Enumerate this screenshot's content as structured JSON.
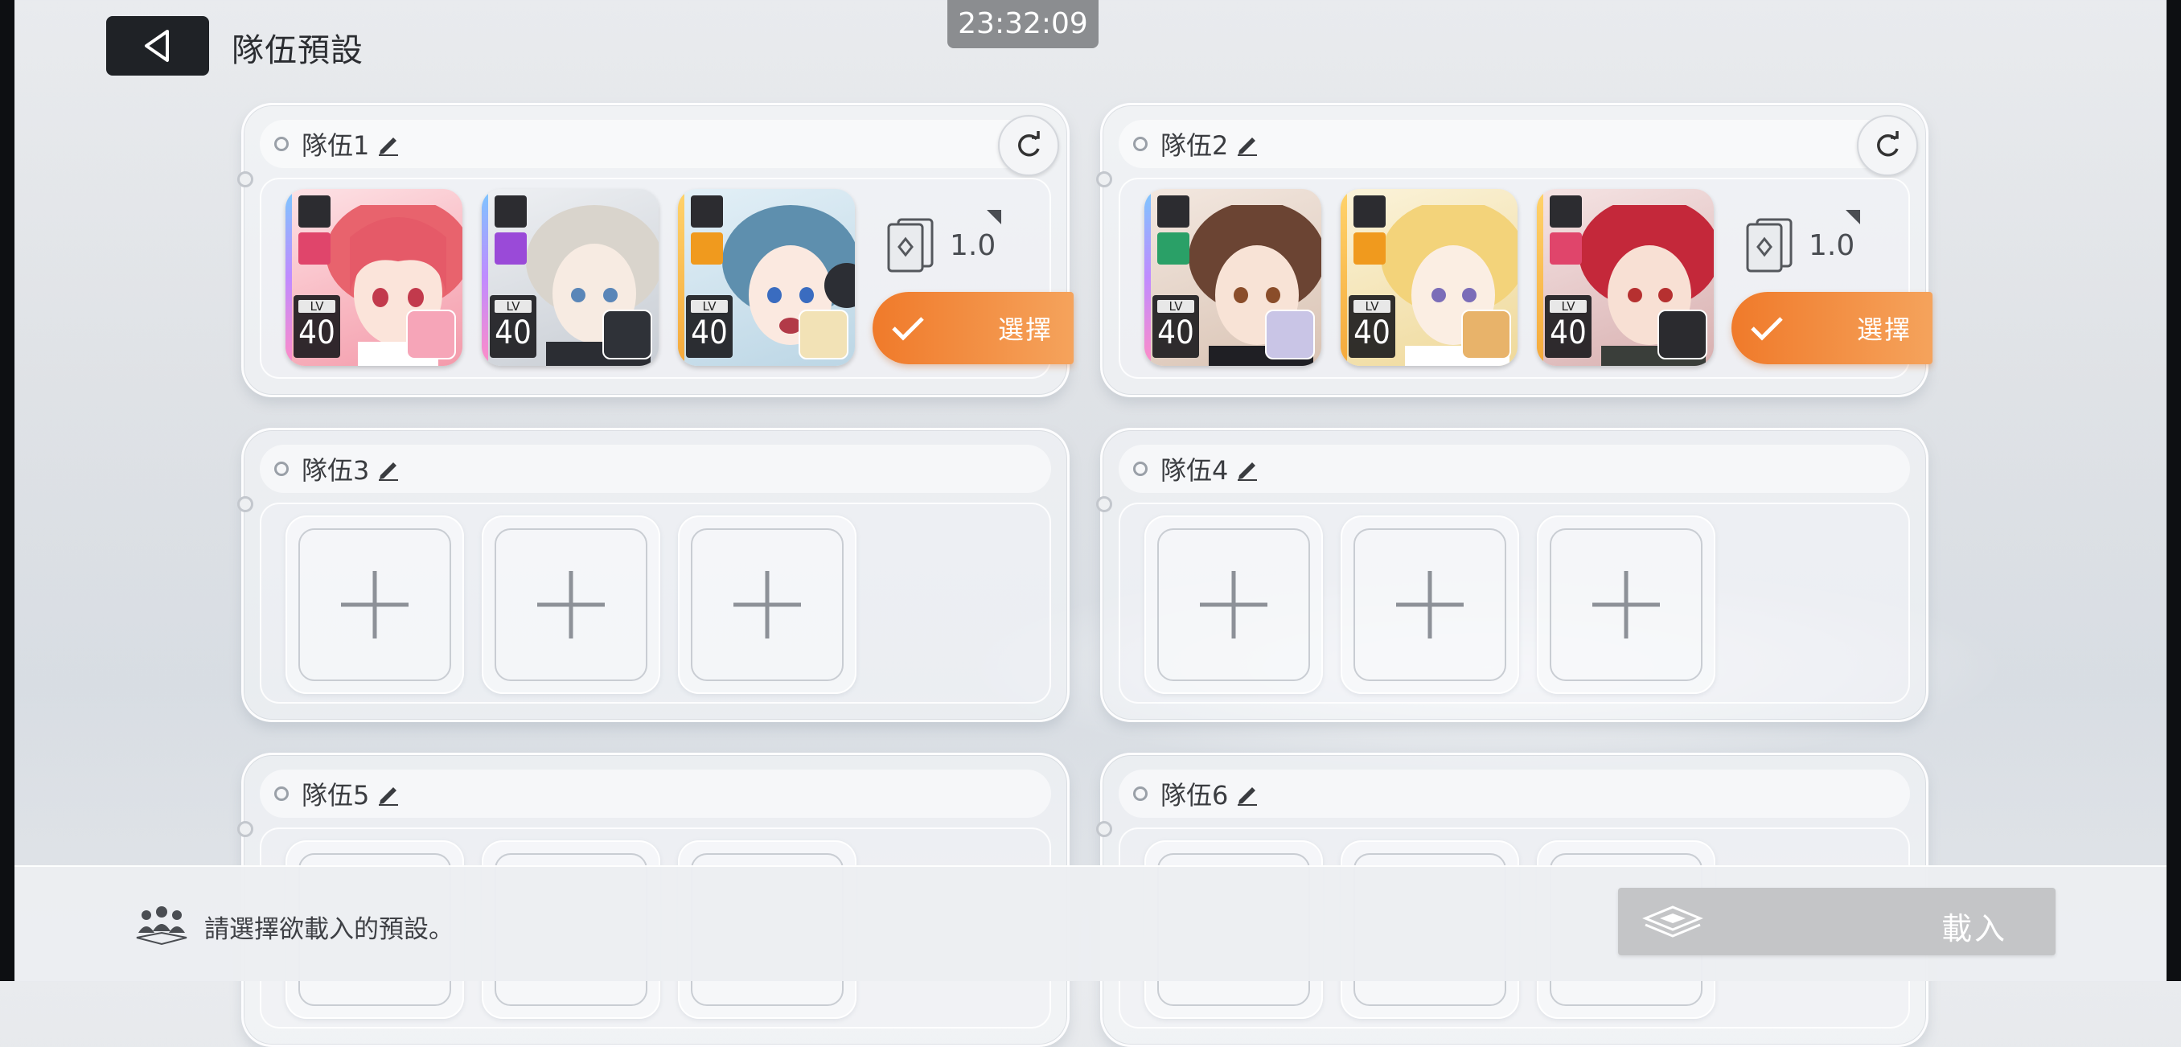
{
  "status_bar": {
    "time": "23:32:09"
  },
  "header": {
    "title": "隊伍預設"
  },
  "teams": [
    {
      "name": "隊伍1",
      "members": [
        {
          "level_tag": "LV",
          "level": "40",
          "element_color": "#e0456b"
        },
        {
          "level_tag": "LV",
          "level": "40",
          "element_color": "#9a4ad8"
        },
        {
          "level_tag": "LV",
          "level": "40",
          "element_color": "#f09a1e"
        }
      ],
      "cost": "1.0",
      "select_label": "選擇"
    },
    {
      "name": "隊伍2",
      "members": [
        {
          "level_tag": "LV",
          "level": "40",
          "element_color": "#2aa067"
        },
        {
          "level_tag": "LV",
          "level": "40",
          "element_color": "#f09a1e"
        },
        {
          "level_tag": "LV",
          "level": "40",
          "element_color": "#e0456b"
        }
      ],
      "cost": "1.0",
      "select_label": "選擇"
    },
    {
      "name": "隊伍3"
    },
    {
      "name": "隊伍4"
    },
    {
      "name": "隊伍5"
    },
    {
      "name": "隊伍6"
    }
  ],
  "footer": {
    "hint": "請選擇欲載入的預設。",
    "load_label": "載入"
  },
  "colors": {
    "accent_orange": "#f07a2a",
    "disabled_gray": "#c4c5c7"
  }
}
